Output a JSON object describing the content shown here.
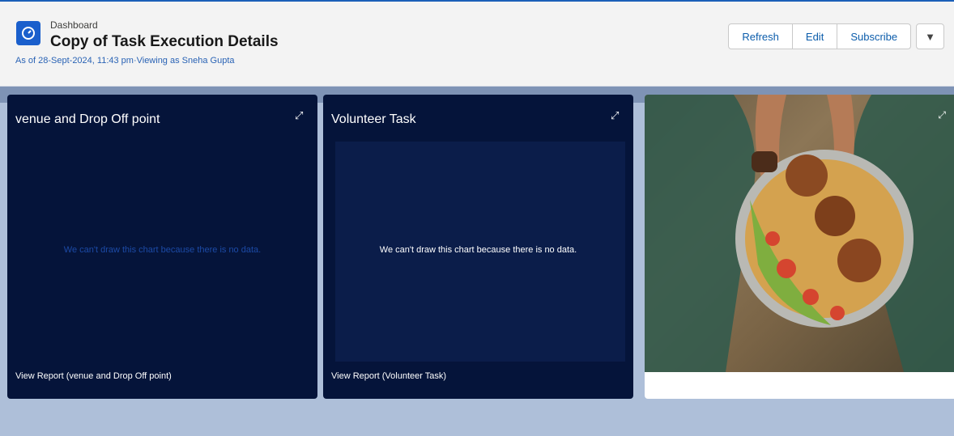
{
  "header": {
    "breadcrumb": "Dashboard",
    "title": "Copy of Task Execution Details",
    "subtitle": "As of 28-Sept-2024, 11:43 pm·Viewing as Sneha Gupta",
    "buttons": {
      "refresh": "Refresh",
      "edit": "Edit",
      "subscribe": "Subscribe"
    }
  },
  "panels": [
    {
      "title": "venue and Drop Off point",
      "no_data": "We can't draw this chart because there is no data.",
      "report_link": "View Report (venue and Drop Off point)"
    },
    {
      "title": "Volunteer Task",
      "no_data": "We can't draw this chart because there is no data.",
      "report_link": "View Report (Volunteer Task)"
    }
  ],
  "colors": {
    "accent": "#1b5fb8",
    "panel_bg": "#05143a",
    "canvas_bg": "#aebfd9"
  }
}
